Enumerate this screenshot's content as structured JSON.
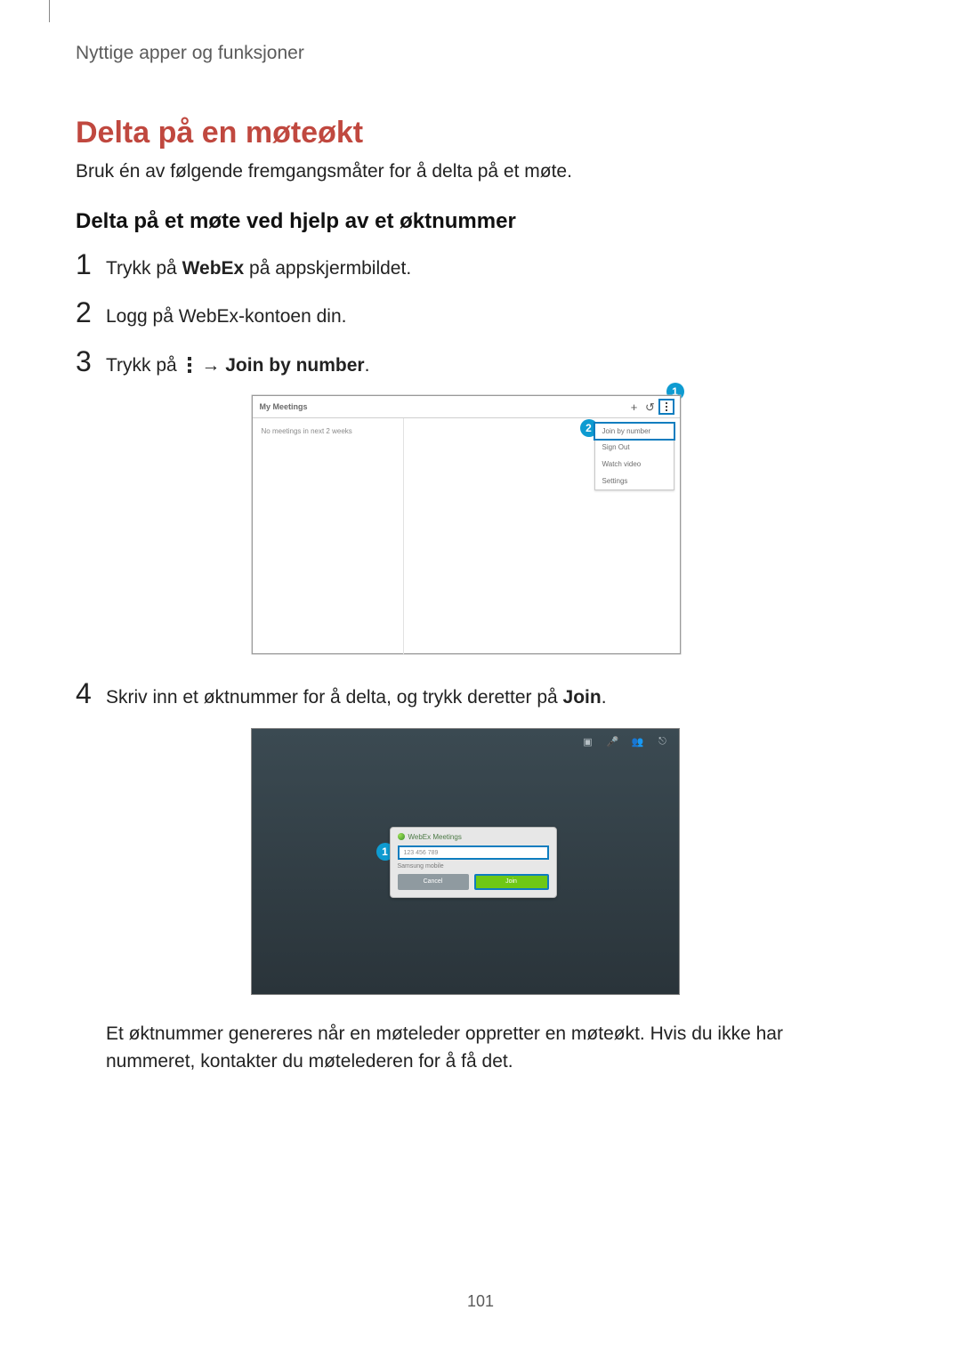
{
  "header": "Nyttige apper og funksjoner",
  "section_title": "Delta på en møteøkt",
  "intro": "Bruk én av følgende fremgangsmåter for å delta på et møte.",
  "subheading": "Delta på et møte ved hjelp av et øktnummer",
  "steps": {
    "s1_pre": "Trykk på ",
    "s1_bold": "WebEx",
    "s1_post": " på appskjermbildet.",
    "s2": "Logg på WebEx-kontoen din.",
    "s3_pre": "Trykk på ",
    "s3_arrow": " → ",
    "s3_bold": "Join by number",
    "s3_post": ".",
    "s4_pre": "Skriv inn et øktnummer for å delta, og trykk deretter på ",
    "s4_bold": "Join",
    "s4_post": "."
  },
  "nums": {
    "n1": "1",
    "n2": "2",
    "n3": "3",
    "n4": "4"
  },
  "fig1": {
    "title": "My Meetings",
    "side_text": "No meetings in next 2 weeks",
    "plus": "+",
    "menu": {
      "join_by_number": "Join by number",
      "sign_out": "Sign Out",
      "watch_video": "Watch video",
      "settings": "Settings"
    }
  },
  "fig2": {
    "dlg_title": "WebEx Meetings",
    "placeholder": "123 456 789",
    "sub": "Samsung mobile",
    "cancel": "Cancel",
    "join": "Join"
  },
  "callouts": {
    "one": "1",
    "two": "2"
  },
  "after_para": "Et øktnummer genereres når en møteleder oppretter en møteøkt. Hvis du ikke har nummeret, kontakter du møtelederen for å få det.",
  "page_num": "101"
}
